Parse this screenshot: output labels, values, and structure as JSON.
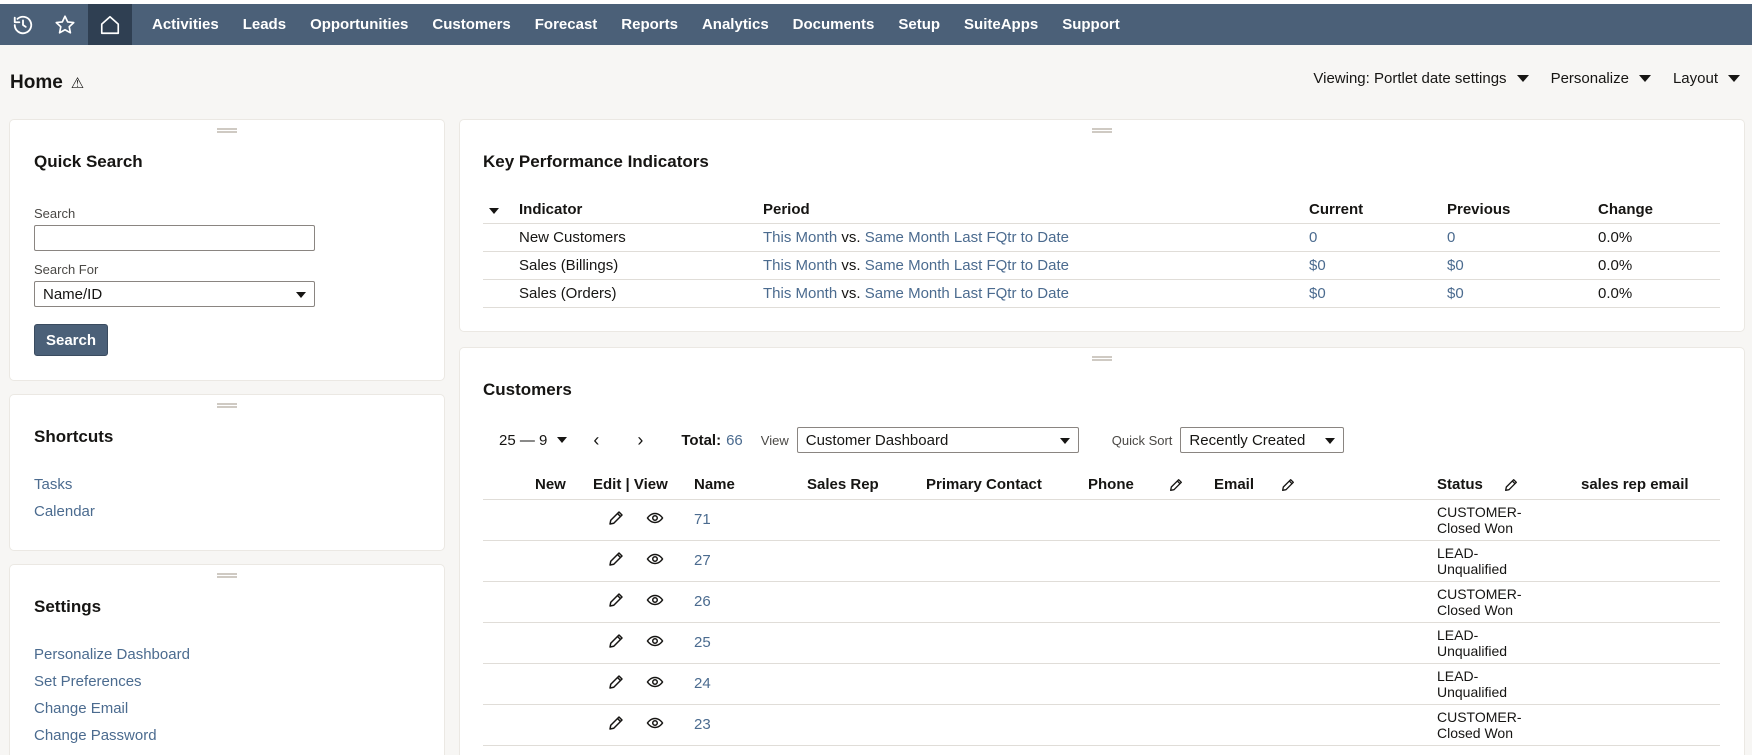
{
  "nav": {
    "items": [
      "Activities",
      "Leads",
      "Opportunities",
      "Customers",
      "Forecast",
      "Reports",
      "Analytics",
      "Documents",
      "Setup",
      "SuiteApps",
      "Support"
    ]
  },
  "page": {
    "title": "Home",
    "viewing_label": "Viewing: Portlet date settings",
    "personalize_label": "Personalize",
    "layout_label": "Layout"
  },
  "quick_search": {
    "title": "Quick Search",
    "search_label": "Search",
    "search_value": "",
    "search_for_label": "Search For",
    "search_for_value": "Name/ID",
    "button": "Search"
  },
  "shortcuts": {
    "title": "Shortcuts",
    "items": [
      "Tasks",
      "Calendar"
    ]
  },
  "settings": {
    "title": "Settings",
    "items": [
      "Personalize Dashboard",
      "Set Preferences",
      "Change Email",
      "Change Password"
    ]
  },
  "kpi": {
    "title": "Key Performance Indicators",
    "headers": [
      "Indicator",
      "Period",
      "Current",
      "Previous",
      "Change"
    ],
    "rows": [
      {
        "indicator": "New Customers",
        "period_a": "This Month",
        "vs": "vs.",
        "period_b": "Same Month Last FQtr to Date",
        "current": "0",
        "previous": "0",
        "change": "0.0%"
      },
      {
        "indicator": "Sales (Billings)",
        "period_a": "This Month",
        "vs": "vs.",
        "period_b": "Same Month Last FQtr to Date",
        "current": "$0",
        "previous": "$0",
        "change": "0.0%"
      },
      {
        "indicator": "Sales (Orders)",
        "period_a": "This Month",
        "vs": "vs.",
        "period_b": "Same Month Last FQtr to Date",
        "current": "$0",
        "previous": "$0",
        "change": "0.0%"
      }
    ]
  },
  "customers": {
    "title": "Customers",
    "range": "25 — 9",
    "total_label": "Total:",
    "total_value": "66",
    "view_label": "View",
    "view_value": "Customer Dashboard",
    "quick_sort_label": "Quick Sort",
    "quick_sort_value": "Recently Created",
    "headers": {
      "new": "New",
      "edit_view": "Edit | View",
      "name": "Name",
      "sales_rep": "Sales Rep",
      "primary_contact": "Primary Contact",
      "phone": "Phone",
      "email": "Email",
      "status": "Status",
      "sales_rep_email": "sales rep email"
    },
    "rows": [
      {
        "name": "71",
        "status_1": "CUSTOMER-",
        "status_2": "Closed Won"
      },
      {
        "name": "27",
        "status_1": "LEAD-",
        "status_2": "Unqualified"
      },
      {
        "name": "26",
        "status_1": "CUSTOMER-",
        "status_2": "Closed Won"
      },
      {
        "name": "25",
        "status_1": "LEAD-",
        "status_2": "Unqualified"
      },
      {
        "name": "24",
        "status_1": "LEAD-",
        "status_2": "Unqualified"
      },
      {
        "name": "23",
        "status_1": "CUSTOMER-",
        "status_2": "Closed Won"
      }
    ]
  }
}
